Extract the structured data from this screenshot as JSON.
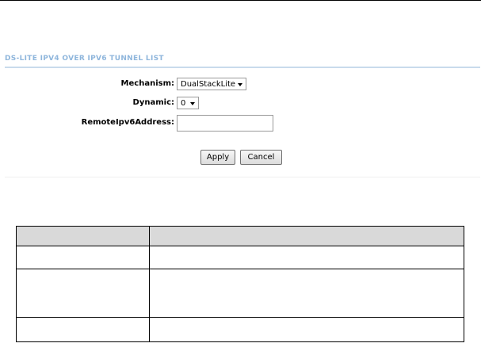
{
  "section": {
    "title": "DS-LITE IPV4 OVER IPV6 TUNNEL LIST"
  },
  "form": {
    "mechanism": {
      "label": "Mechanism:",
      "value": "DualStackLite"
    },
    "dynamic": {
      "label": "Dynamic:",
      "value": "0"
    },
    "remote_ipv6": {
      "label": "RemoteIpv6Address:",
      "value": ""
    }
  },
  "buttons": {
    "apply": "Apply",
    "cancel": "Cancel"
  },
  "table": {
    "headers": [
      "",
      ""
    ],
    "rows": [
      [
        "",
        ""
      ],
      [
        "",
        ""
      ],
      [
        "",
        ""
      ]
    ]
  },
  "colors": {
    "title": "#8fb6dc",
    "title_rule": "#c9dbec",
    "table_header_bg": "#d9d9d9"
  }
}
